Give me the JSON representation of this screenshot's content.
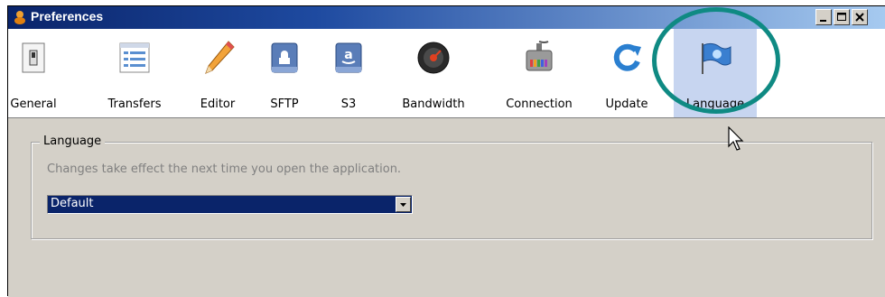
{
  "window": {
    "title": "Preferences",
    "controls": [
      "minimize-icon",
      "maximize-icon",
      "close-icon"
    ]
  },
  "toolbar": {
    "items": [
      {
        "label": "General",
        "icon": "switch-icon"
      },
      {
        "label": "Transfers",
        "icon": "transfers-list-icon"
      },
      {
        "label": "Editor",
        "icon": "pencil-icon"
      },
      {
        "label": "SFTP",
        "icon": "sftp-drive-icon"
      },
      {
        "label": "S3",
        "icon": "amazon-s3-icon"
      },
      {
        "label": "Bandwidth",
        "icon": "speedometer-icon"
      },
      {
        "label": "Connection",
        "icon": "network-plug-icon"
      },
      {
        "label": "Update",
        "icon": "update-refresh-icon"
      },
      {
        "label": "Language",
        "icon": "flag-icon"
      }
    ],
    "selected": "Language"
  },
  "language_panel": {
    "legend": "Language",
    "help_text": "Changes take effect the next time you open the application.",
    "select_value": "Default"
  },
  "colors": {
    "title_bar": "#0a246a",
    "selected_tab": "#c7d5f0",
    "annotation_ring": "#0f8a83",
    "select_highlight": "#0a246a"
  }
}
